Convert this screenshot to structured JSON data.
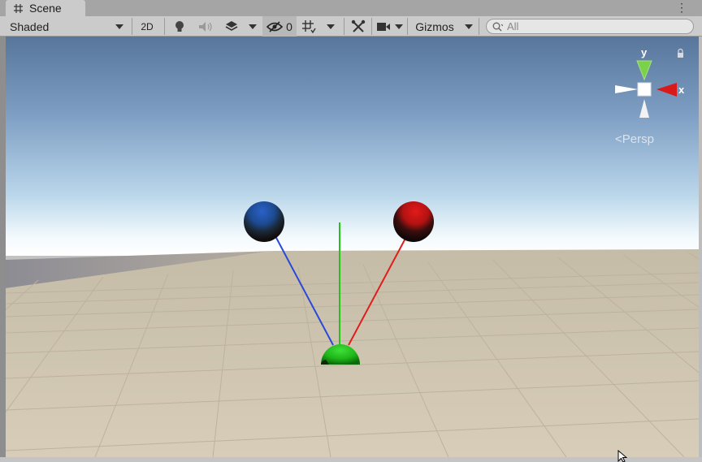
{
  "tab": {
    "title": "Scene",
    "icon": "grid-hash-icon"
  },
  "toolbar": {
    "draw_mode": "Shaded",
    "mode_2d": "2D",
    "hidden_count": "0",
    "gizmos_label": "Gizmos"
  },
  "search": {
    "placeholder": "All"
  },
  "gizmo": {
    "x_label": "x",
    "y_label": "y",
    "projection_label": "Persp"
  },
  "colors": {
    "accent_red": "#e01e1e",
    "accent_green": "#22c31a",
    "accent_blue": "#2b49d8"
  }
}
